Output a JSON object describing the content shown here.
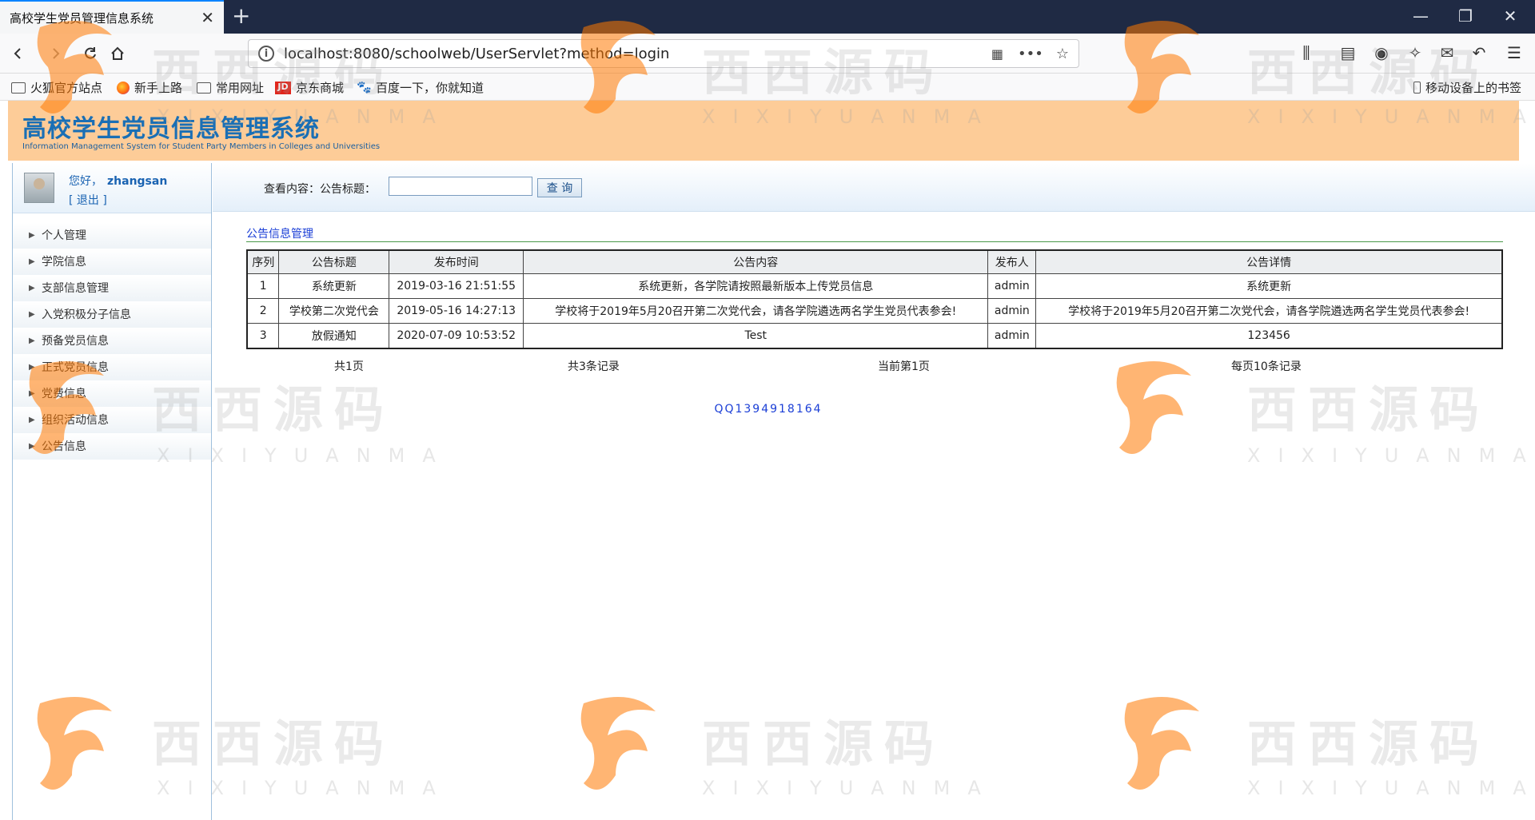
{
  "browser": {
    "tab_title": "高校学生党员管理信息系统",
    "tab_close": "✕",
    "new_tab": "+",
    "window_controls": {
      "minimize": "—",
      "restore": "❐",
      "close": "✕"
    },
    "url": "localhost:8080/schoolweb/UserServlet?method=login",
    "nav_icons": [
      "back-icon",
      "forward-icon",
      "reload-icon",
      "home-icon"
    ],
    "bookmarks": [
      {
        "label": "火狐官方站点",
        "icon": "folder-icon"
      },
      {
        "label": "新手上路",
        "icon": "firefox-icon"
      },
      {
        "label": "常用网址",
        "icon": "folder-icon"
      },
      {
        "label": "京东商城",
        "icon": "jd-icon",
        "icon_text": "JD"
      },
      {
        "label": "百度一下，你就知道",
        "icon": "baidu-icon"
      }
    ],
    "mobile_bookmarks": "移动设备上的书签"
  },
  "header": {
    "title": "高校学生党员信息管理系统",
    "subtitle": "Information Management System for Student Party Members in Colleges and Universities"
  },
  "user": {
    "greeting": "您好，",
    "username": "zhangsan",
    "logout": "[ 退出 ]"
  },
  "menu": [
    {
      "label": "个人管理"
    },
    {
      "label": "学院信息"
    },
    {
      "label": "支部信息管理"
    },
    {
      "label": "入党积极分子信息"
    },
    {
      "label": "预备党员信息"
    },
    {
      "label": "正式党员信息"
    },
    {
      "label": "党费信息"
    },
    {
      "label": "组织活动信息"
    },
    {
      "label": "公告信息"
    }
  ],
  "search": {
    "label": "查看内容：公告标题：",
    "value": "",
    "button": "查 询"
  },
  "section": {
    "title": "公告信息管理"
  },
  "table": {
    "headers": [
      "序列",
      "公告标题",
      "发布时间",
      "公告内容",
      "发布人",
      "公告详情"
    ],
    "rows": [
      [
        "1",
        "系统更新",
        "2019-03-16 21:51:55",
        "系统更新，各学院请按照最新版本上传党员信息",
        "admin",
        "系统更新"
      ],
      [
        "2",
        "学校第二次党代会",
        "2019-05-16 14:27:13",
        "学校将于2019年5月20召开第二次党代会，请各学院遴选两名学生党员代表参会!",
        "admin",
        "学校将于2019年5月20召开第二次党代会，请各学院遴选两名学生党员代表参会!"
      ],
      [
        "3",
        "放假通知",
        "2020-07-09 10:53:52",
        "Test",
        "admin",
        "123456"
      ]
    ]
  },
  "pager": {
    "total_pages": "共1页",
    "total_records": "共3条记录",
    "current_page": "当前第1页",
    "per_page": "每页10条记录"
  },
  "footer": {
    "qq": "QQ1394918164"
  },
  "watermark": {
    "text": "西西源码",
    "sub": "XIXIYUANMA"
  },
  "colors": {
    "header_bg": "#fdcc98",
    "link_blue": "#1a3ed6",
    "tabbar_bg": "#1f2a44"
  }
}
